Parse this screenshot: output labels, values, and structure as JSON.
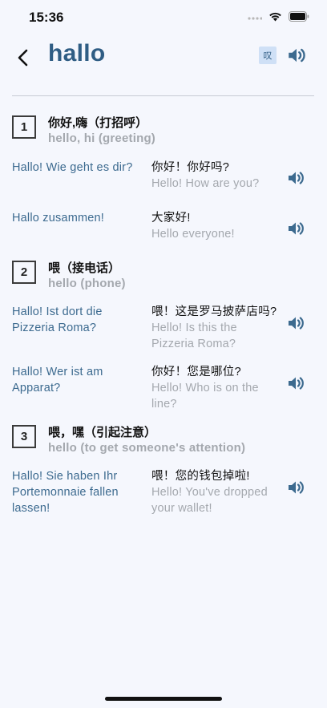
{
  "status_bar": {
    "time": "15:36"
  },
  "header": {
    "title": "hallo",
    "dict_badge": "叹"
  },
  "senses": [
    {
      "number": "1",
      "zh": "你好,嗨（打招呼）",
      "en": "hello, hi (greeting)",
      "examples": [
        {
          "de": "Hallo! Wie geht es dir?",
          "zh": "你好！你好吗?",
          "en": "Hello! How are you?"
        },
        {
          "de": "Hallo zusammen!",
          "zh": "大家好!",
          "en": "Hello everyone!"
        }
      ]
    },
    {
      "number": "2",
      "zh": "喂（接电话）",
      "en": "hello (phone)",
      "examples": [
        {
          "de": "Hallo! Ist dort die Pizzeria Roma?",
          "zh": "喂！这是罗马披萨店吗?",
          "en": "Hello! Is this the Pizzeria Roma?"
        },
        {
          "de": "Hallo! Wer ist am Apparat?",
          "zh": "你好！您是哪位?",
          "en": "Hello! Who is on the line?"
        }
      ]
    },
    {
      "number": "3",
      "zh": "喂，嘿（引起注意）",
      "en": "hello (to get someone's attention)",
      "examples": [
        {
          "de": "Hallo! Sie haben Ihr Portemonnaie fallen lassen!",
          "zh": "喂！您的钱包掉啦!",
          "en": "Hello! You've dropped your wallet!"
        }
      ]
    }
  ],
  "colors": {
    "accent": "#2f5d84",
    "german_text": "#3c6a8f",
    "muted": "#a4a8ae",
    "background": "#f5f7fd",
    "badge_bg": "#cfe0f6"
  },
  "icons": [
    "back-chevron-icon",
    "speaker-icon",
    "signal-icon",
    "wifi-icon",
    "battery-icon"
  ]
}
